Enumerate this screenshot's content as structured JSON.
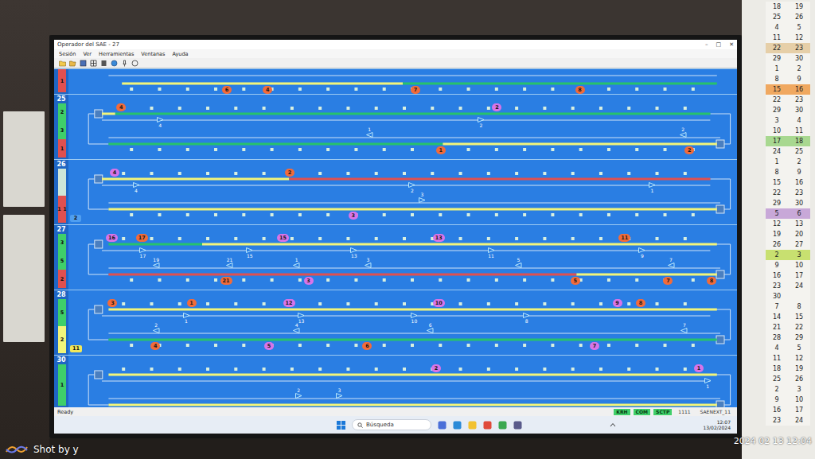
{
  "window": {
    "title": "Operador del SAE - 27",
    "controls": [
      "–",
      "□",
      "✕"
    ]
  },
  "menu": [
    "Sesión",
    "Ver",
    "Herramientas",
    "Ventanas",
    "Ayuda"
  ],
  "lines": [
    {
      "kind": "partial",
      "strips": [
        {
          "text": "1",
          "color": "#e05050"
        }
      ],
      "tags": [],
      "upper": [],
      "lower": [
        {
          "from": 0.08,
          "to": 0.5,
          "color": "#f2f57a"
        },
        {
          "from": 0.5,
          "to": 0.97,
          "color": "#27c26c"
        }
      ],
      "trains": [
        {
          "label": "6",
          "track": "lower",
          "position": 0.237,
          "color": "#f26b3a"
        },
        {
          "label": "4",
          "track": "lower",
          "position": 0.298,
          "color": "#f26b3a"
        },
        {
          "label": "7",
          "track": "lower",
          "position": 0.519,
          "color": "#f26b3a"
        },
        {
          "label": "8",
          "track": "lower",
          "position": 0.765,
          "color": "#f26b3a"
        }
      ],
      "arrows": []
    },
    {
      "kind": "full",
      "number": "25",
      "strips": [
        {
          "text": "2",
          "color": "#3fcf6a"
        },
        {
          "text": "3",
          "color": "#3fcf6a"
        },
        {
          "text": "1",
          "color": "#e05050"
        }
      ],
      "tags": [],
      "upper": [
        {
          "from": 0.05,
          "to": 0.07,
          "color": "#f2f57a"
        },
        {
          "from": 0.07,
          "to": 0.96,
          "color": "#27c26c"
        }
      ],
      "lower": [
        {
          "from": 0.06,
          "to": 0.56,
          "color": "#27c26c"
        },
        {
          "from": 0.56,
          "to": 0.97,
          "color": "#f2f57a"
        }
      ],
      "trains": [
        {
          "label": "4",
          "track": "upper",
          "position": 0.079,
          "color": "#f26b3a"
        },
        {
          "label": "2",
          "track": "upper",
          "position": 0.641,
          "color": "#d874e8"
        },
        {
          "label": "1",
          "track": "lower",
          "position": 0.557,
          "color": "#f26b3a"
        },
        {
          "label": "2",
          "track": "lower",
          "position": 0.929,
          "color": "#f26b3a"
        }
      ],
      "arrows": [
        {
          "label": "4",
          "track": "upper",
          "position": 0.136,
          "direction": "right"
        },
        {
          "label": "2",
          "track": "upper",
          "position": 0.616,
          "direction": "right"
        },
        {
          "label": "1",
          "track": "lower",
          "position": 0.449,
          "direction": "left"
        },
        {
          "label": "2",
          "track": "lower",
          "position": 0.918,
          "direction": "left"
        }
      ]
    },
    {
      "kind": "full",
      "number": "26",
      "strips": [
        {
          "text": "",
          "color": "#cfe6d8"
        },
        {
          "text": "1 1",
          "color": "#e05050"
        }
      ],
      "tags": [
        {
          "text": "2",
          "color": "#4f9ef0"
        }
      ],
      "upper": [
        {
          "from": 0.05,
          "to": 0.33,
          "color": "#f2f57a"
        },
        {
          "from": 0.33,
          "to": 0.96,
          "color": "#e05050"
        }
      ],
      "lower": [
        {
          "from": 0.06,
          "to": 0.97,
          "color": "#f2f57a"
        }
      ],
      "trains": [
        {
          "label": "4",
          "track": "upper",
          "position": 0.069,
          "color": "#d874e8"
        },
        {
          "label": "2",
          "track": "upper",
          "position": 0.331,
          "color": "#f26b3a"
        },
        {
          "label": "3",
          "track": "lower",
          "position": 0.426,
          "color": "#d874e8"
        }
      ],
      "arrows": [
        {
          "label": "4",
          "track": "upper",
          "position": 0.1,
          "direction": "right"
        },
        {
          "label": "2",
          "track": "upper",
          "position": 0.513,
          "direction": "right"
        },
        {
          "label": "3",
          "track": "lower",
          "position": 0.528,
          "direction": "right"
        },
        {
          "label": "1",
          "track": "upper",
          "position": 0.872,
          "direction": "right"
        }
      ]
    },
    {
      "kind": "full",
      "number": "27",
      "strips": [
        {
          "text": "3",
          "color": "#3fcf6a"
        },
        {
          "text": "5",
          "color": "#3fcf6a"
        },
        {
          "text": "2",
          "color": "#e05050"
        }
      ],
      "tags": [],
      "upper": [
        {
          "from": 0.06,
          "to": 0.2,
          "color": "#27c26c"
        },
        {
          "from": 0.2,
          "to": 0.97,
          "color": "#f2f57a"
        }
      ],
      "lower": [
        {
          "from": 0.06,
          "to": 0.76,
          "color": "#e05050"
        },
        {
          "from": 0.76,
          "to": 0.97,
          "color": "#f2f57a"
        }
      ],
      "trains": [
        {
          "label": "16",
          "track": "upper",
          "position": 0.063,
          "color": "#d874e8"
        },
        {
          "label": "17",
          "track": "upper",
          "position": 0.108,
          "color": "#f26b3a"
        },
        {
          "label": "15",
          "track": "upper",
          "position": 0.319,
          "color": "#d874e8"
        },
        {
          "label": "13",
          "track": "upper",
          "position": 0.552,
          "color": "#d874e8"
        },
        {
          "label": "11",
          "track": "upper",
          "position": 0.83,
          "color": "#f26b3a"
        },
        {
          "label": "21",
          "track": "lower",
          "position": 0.234,
          "color": "#f26b3a"
        },
        {
          "label": "3",
          "track": "lower",
          "position": 0.359,
          "color": "#d874e8"
        },
        {
          "label": "5",
          "track": "lower",
          "position": 0.758,
          "color": "#f26b3a"
        },
        {
          "label": "7",
          "track": "lower",
          "position": 0.897,
          "color": "#f26b3a"
        },
        {
          "label": "8",
          "track": "lower",
          "position": 0.962,
          "color": "#f26b3a"
        }
      ],
      "arrows": [
        {
          "label": "17",
          "track": "upper",
          "position": 0.11,
          "direction": "right"
        },
        {
          "label": "15",
          "track": "upper",
          "position": 0.27,
          "direction": "right"
        },
        {
          "label": "13",
          "track": "upper",
          "position": 0.426,
          "direction": "right"
        },
        {
          "label": "11",
          "track": "upper",
          "position": 0.631,
          "direction": "right"
        },
        {
          "label": "9",
          "track": "upper",
          "position": 0.857,
          "direction": "right"
        },
        {
          "label": "19",
          "track": "lower",
          "position": 0.13,
          "direction": "left"
        },
        {
          "label": "21",
          "track": "lower",
          "position": 0.24,
          "direction": "left"
        },
        {
          "label": "1",
          "track": "lower",
          "position": 0.34,
          "direction": "left"
        },
        {
          "label": "3",
          "track": "lower",
          "position": 0.447,
          "direction": "left"
        },
        {
          "label": "5",
          "track": "lower",
          "position": 0.672,
          "direction": "left"
        },
        {
          "label": "7",
          "track": "lower",
          "position": 0.9,
          "direction": "left"
        }
      ]
    },
    {
      "kind": "full",
      "number": "28",
      "strips": [
        {
          "text": "5",
          "color": "#3fcf6a"
        },
        {
          "text": "2",
          "color": "#f2f57a"
        }
      ],
      "tags": [
        {
          "text": "11",
          "color": "#f2e85a"
        }
      ],
      "upper": [
        {
          "from": 0.06,
          "to": 0.97,
          "color": "#f2f57a"
        }
      ],
      "lower": [
        {
          "from": 0.06,
          "to": 0.97,
          "color": "#27c26c"
        }
      ],
      "trains": [
        {
          "label": "3",
          "track": "upper",
          "position": 0.066,
          "color": "#f26b3a"
        },
        {
          "label": "1",
          "track": "upper",
          "position": 0.184,
          "color": "#f26b3a"
        },
        {
          "label": "12",
          "track": "upper",
          "position": 0.328,
          "color": "#d874e8"
        },
        {
          "label": "10",
          "track": "upper",
          "position": 0.552,
          "color": "#d874e8"
        },
        {
          "label": "9",
          "track": "upper",
          "position": 0.821,
          "color": "#d874e8"
        },
        {
          "label": "8",
          "track": "upper",
          "position": 0.856,
          "color": "#f26b3a"
        },
        {
          "label": "4",
          "track": "lower",
          "position": 0.13,
          "color": "#f26b3a"
        },
        {
          "label": "5",
          "track": "lower",
          "position": 0.3,
          "color": "#d874e8"
        },
        {
          "label": "6",
          "track": "lower",
          "position": 0.447,
          "color": "#f26b3a"
        },
        {
          "label": "7",
          "track": "lower",
          "position": 0.787,
          "color": "#d874e8"
        }
      ],
      "arrows": [
        {
          "label": "1",
          "track": "upper",
          "position": 0.175,
          "direction": "right"
        },
        {
          "label": "13",
          "track": "upper",
          "position": 0.347,
          "direction": "right"
        },
        {
          "label": "10",
          "track": "upper",
          "position": 0.516,
          "direction": "right"
        },
        {
          "label": "8",
          "track": "upper",
          "position": 0.684,
          "direction": "right"
        },
        {
          "label": "2",
          "track": "lower",
          "position": 0.13,
          "direction": "left"
        },
        {
          "label": "4",
          "track": "lower",
          "position": 0.34,
          "direction": "left"
        },
        {
          "label": "6",
          "track": "lower",
          "position": 0.54,
          "direction": "left"
        },
        {
          "label": "7",
          "track": "lower",
          "position": 0.92,
          "direction": "left"
        }
      ]
    },
    {
      "kind": "full",
      "number": "30",
      "strips": [
        {
          "text": "1",
          "color": "#3fcf6a"
        }
      ],
      "tags": [],
      "upper": [
        {
          "from": 0.06,
          "to": 0.97,
          "color": "#f2f57a"
        }
      ],
      "lower": [
        {
          "from": 0.06,
          "to": 0.97,
          "color": "#f2f57a"
        }
      ],
      "trains": [
        {
          "label": "2",
          "track": "upper",
          "position": 0.55,
          "color": "#d874e8"
        },
        {
          "label": "1",
          "track": "upper",
          "position": 0.943,
          "color": "#d874e8"
        }
      ],
      "arrows": [
        {
          "label": "1",
          "track": "upper",
          "position": 0.955,
          "direction": "right"
        },
        {
          "label": "2",
          "track": "lower",
          "position": 0.343,
          "direction": "right"
        },
        {
          "label": "3",
          "track": "lower",
          "position": 0.404,
          "direction": "right"
        }
      ]
    }
  ],
  "status_bar": {
    "text": "Ready",
    "indicators": [
      {
        "label": "KRH",
        "on": true
      },
      {
        "label": "COM",
        "on": true
      },
      {
        "label": "SCTP",
        "on": true
      }
    ],
    "fields": [
      "1111",
      "SAENEXT_11"
    ]
  },
  "taskbar": {
    "search": "Búsqueda",
    "time": "12:07",
    "date": "13/02/2024"
  },
  "calendar": [
    {
      "cells": [
        "18",
        "19"
      ],
      "color": "#f4f3ef"
    },
    {
      "cells": [
        "25",
        "26"
      ],
      "color": "#f4f3ef"
    },
    {
      "cells": [
        "4",
        "5"
      ],
      "color": "#f4f3ef"
    },
    {
      "cells": [
        "11",
        "12"
      ],
      "color": "#f4f3ef"
    },
    {
      "cells": [
        "22",
        "23"
      ],
      "color": "#e6cfa8"
    },
    {
      "cells": [
        "29",
        "30"
      ],
      "color": "#f4f3ef"
    },
    {
      "cells": [
        "1",
        "2"
      ],
      "color": "#f4f3ef"
    },
    {
      "cells": [
        "8",
        "9"
      ],
      "color": "#f4f3ef"
    },
    {
      "cells": [
        "15",
        "16"
      ],
      "color": "#f0a860"
    },
    {
      "cells": [
        "22",
        "23"
      ],
      "color": "#f4f3ef"
    },
    {
      "cells": [
        "29",
        "30"
      ],
      "color": "#f4f3ef"
    },
    {
      "cells": [
        "3",
        "4"
      ],
      "color": "#f4f3ef"
    },
    {
      "cells": [
        "10",
        "11"
      ],
      "color": "#f4f3ef"
    },
    {
      "cells": [
        "17",
        "18"
      ],
      "color": "#a8d890"
    },
    {
      "cells": [
        "24",
        "25"
      ],
      "color": "#f4f3ef"
    },
    {
      "cells": [
        "1",
        "2"
      ],
      "color": "#f4f3ef"
    },
    {
      "cells": [
        "8",
        "9"
      ],
      "color": "#f4f3ef"
    },
    {
      "cells": [
        "15",
        "16"
      ],
      "color": "#f4f3ef"
    },
    {
      "cells": [
        "22",
        "23"
      ],
      "color": "#f4f3ef"
    },
    {
      "cells": [
        "29",
        "30"
      ],
      "color": "#f4f3ef"
    },
    {
      "cells": [
        "5",
        "6"
      ],
      "color": "#c8a8d8"
    },
    {
      "cells": [
        "12",
        "13"
      ],
      "color": "#f4f3ef"
    },
    {
      "cells": [
        "19",
        "20"
      ],
      "color": "#f4f3ef"
    },
    {
      "cells": [
        "26",
        "27"
      ],
      "color": "#f4f3ef"
    },
    {
      "cells": [
        "2",
        "3"
      ],
      "color": "#c8e070"
    },
    {
      "cells": [
        "9",
        "10"
      ],
      "color": "#f4f3ef"
    },
    {
      "cells": [
        "16",
        "17"
      ],
      "color": "#f4f3ef"
    },
    {
      "cells": [
        "23",
        "24"
      ],
      "color": "#f4f3ef"
    },
    {
      "cells": [
        "30"
      ],
      "color": "#f4f3ef"
    },
    {
      "cells": [
        "7",
        "8"
      ],
      "color": "#f4f3ef"
    },
    {
      "cells": [
        "14",
        "15"
      ],
      "color": "#f4f3ef"
    },
    {
      "cells": [
        "21",
        "22"
      ],
      "color": "#f4f3ef"
    },
    {
      "cells": [
        "28",
        "29"
      ],
      "color": "#f4f3ef"
    },
    {
      "cells": [
        "4",
        "5"
      ],
      "color": "#f4f3ef"
    },
    {
      "cells": [
        "11",
        "12"
      ],
      "color": "#f4f3ef"
    },
    {
      "cells": [
        "18",
        "19"
      ],
      "color": "#f4f3ef"
    },
    {
      "cells": [
        "25",
        "26"
      ],
      "color": "#f4f3ef"
    },
    {
      "cells": [
        "2",
        "3"
      ],
      "color": "#f4f3ef"
    },
    {
      "cells": [
        "9",
        "10"
      ],
      "color": "#f4f3ef"
    },
    {
      "cells": [
        "16",
        "17"
      ],
      "color": "#f4f3ef"
    },
    {
      "cells": [
        "23",
        "24"
      ],
      "color": "#f4f3ef"
    }
  ],
  "watermark": {
    "brand": "Shot by y",
    "timestamp": "2024 02 13 12:04"
  }
}
